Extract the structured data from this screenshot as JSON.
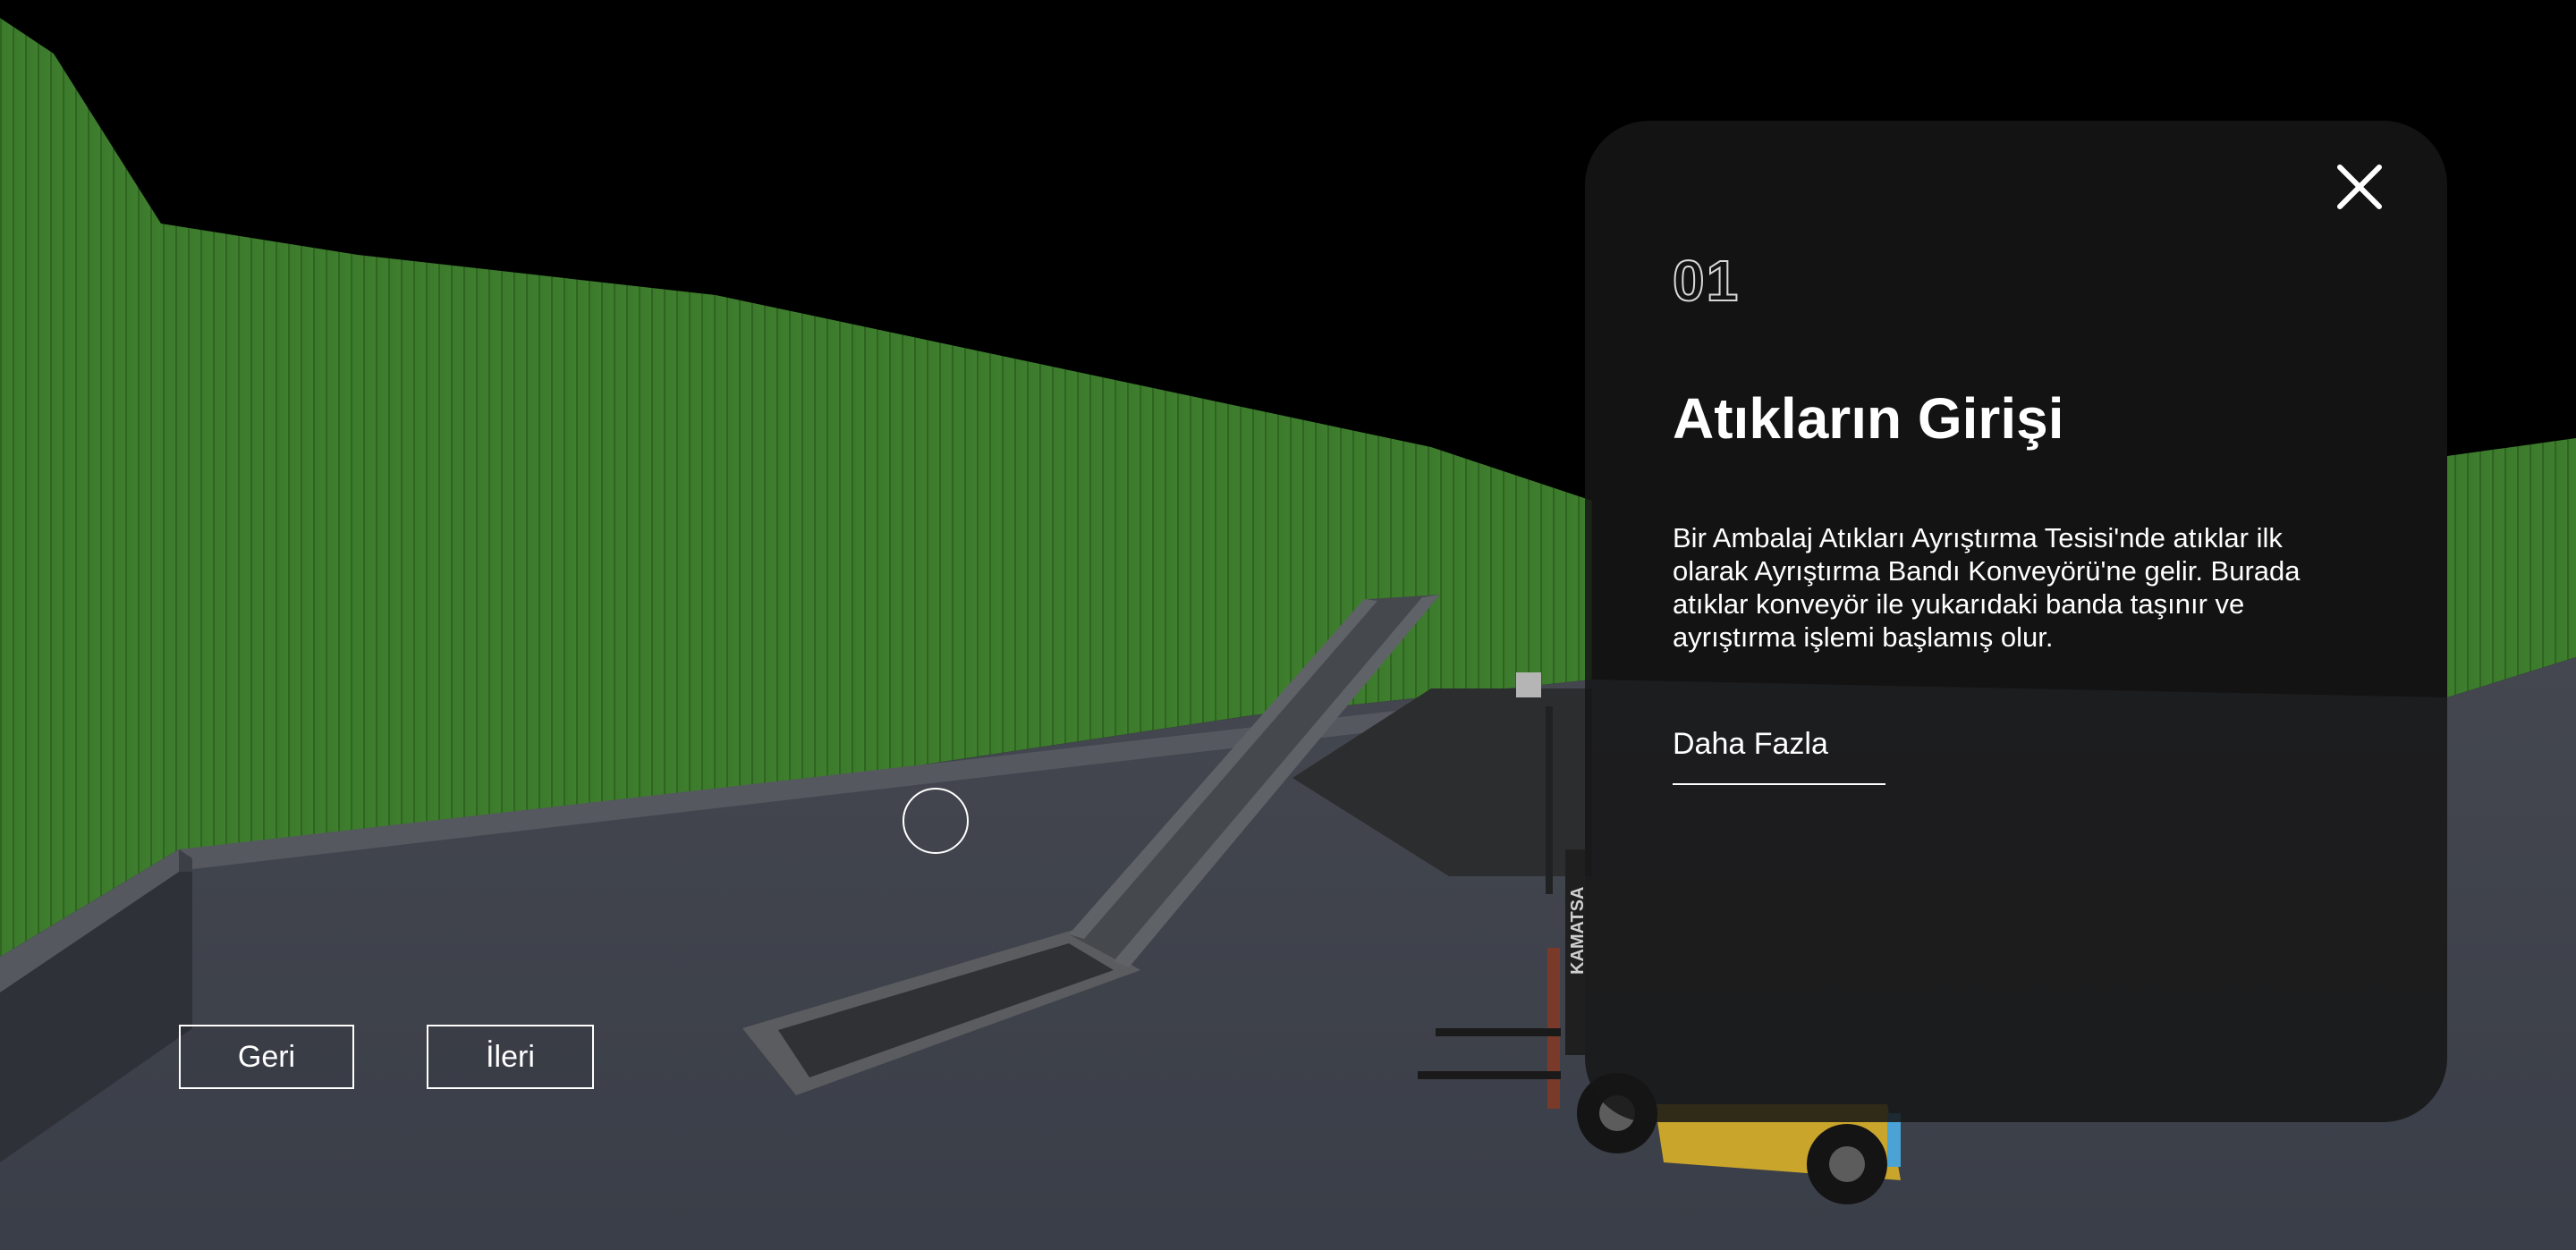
{
  "navigation": {
    "back_label": "Geri",
    "next_label": "İleri"
  },
  "info_panel": {
    "step_number": "01",
    "title": "Atıkların Girişi",
    "body": "Bir Ambalaj Atıkları Ayrıştırma Tesisi'nde atıklar ilk olarak Ayrıştırma Bandı Konveyörü'ne gelir. Burada atıklar konveyör ile yukarıdaki banda taşınır ve ayrıştırma işlemi başlamış olur.",
    "more_label": "Daha Fazla",
    "close_icon": "close-icon"
  },
  "scene": {
    "forklift_brand": "KAMATSA",
    "colors": {
      "sky": "#000000",
      "fence_green": "#3f7a2c",
      "ground": "#3c4049",
      "panel_bg": "#161616",
      "forklift_yellow": "#c9a52c"
    }
  }
}
